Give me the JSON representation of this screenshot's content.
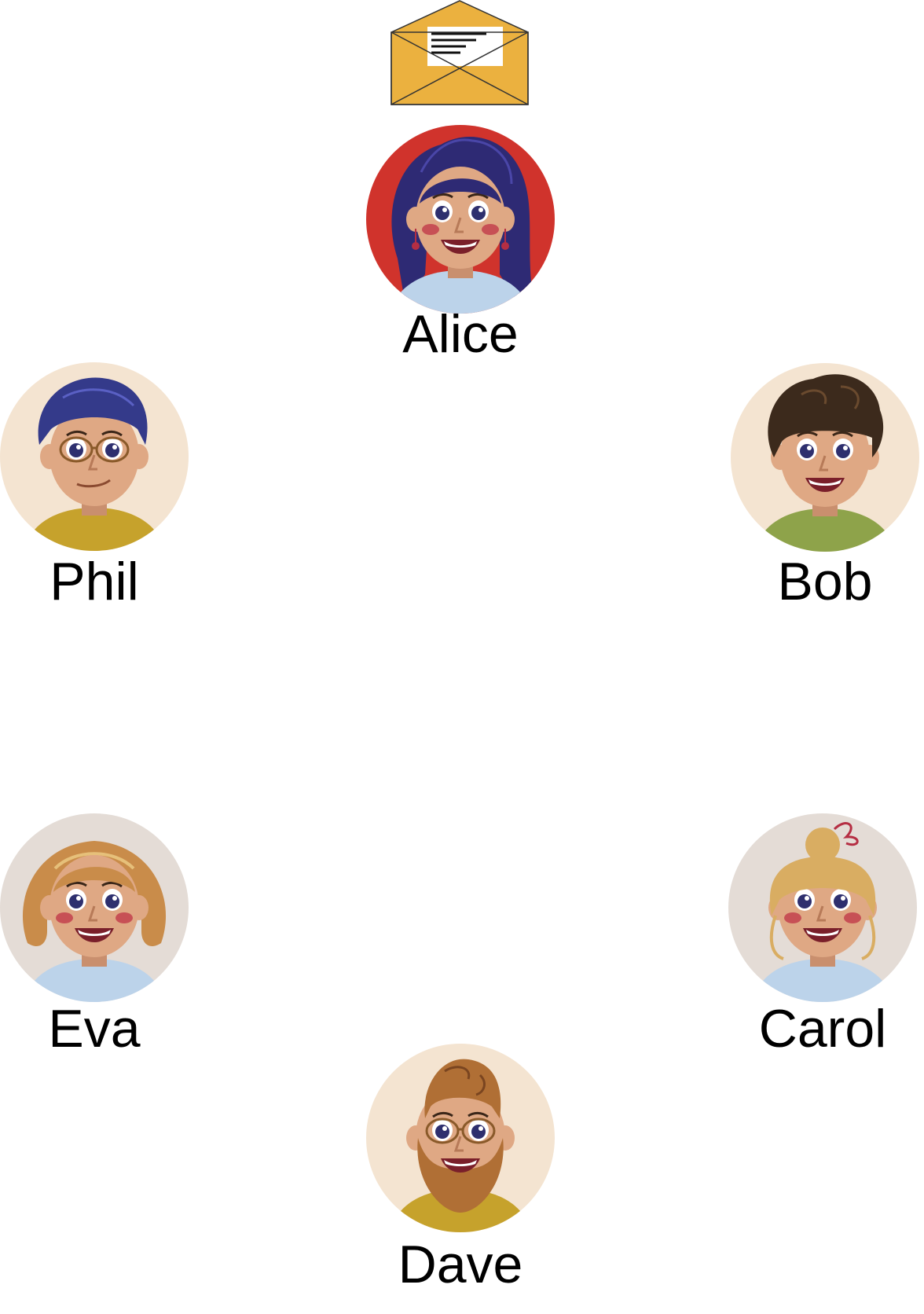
{
  "message_icon": "envelope-icon",
  "people": [
    {
      "id": "alice",
      "name": "Alice",
      "bg": "#d0332c",
      "skin": "#dfa884",
      "hair": "#2e2a74",
      "hair_style": "long-wavy",
      "shirt": "#bcd3ea",
      "glasses": false,
      "beard": false,
      "cheeks": true
    },
    {
      "id": "bob",
      "name": "Bob",
      "bg": "#f4e4d1",
      "skin": "#dfa884",
      "hair": "#3c2a1c",
      "hair_style": "curly-top",
      "shirt": "#8ea34a",
      "glasses": false,
      "beard": false,
      "cheeks": false
    },
    {
      "id": "carol",
      "name": "Carol",
      "bg": "#e4dcd6",
      "skin": "#dfa884",
      "hair": "#d9ad62",
      "hair_style": "bun",
      "shirt": "#bcd3ea",
      "glasses": false,
      "beard": false,
      "cheeks": true
    },
    {
      "id": "dave",
      "name": "Dave",
      "bg": "#f4e4d1",
      "skin": "#dfa884",
      "hair": "#b06f35",
      "hair_style": "wavy-up",
      "shirt": "#c6a22c",
      "glasses": true,
      "beard": true,
      "cheeks": false
    },
    {
      "id": "eva",
      "name": "Eva",
      "bg": "#e4dcd6",
      "skin": "#dfa884",
      "hair": "#c98c4a",
      "hair_style": "bob",
      "shirt": "#bcd3ea",
      "glasses": false,
      "beard": false,
      "cheeks": true
    },
    {
      "id": "phil",
      "name": "Phil",
      "bg": "#f4e4d1",
      "skin": "#dfa884",
      "hair": "#343a8a",
      "hair_style": "short",
      "shirt": "#c6a22c",
      "glasses": true,
      "beard": false,
      "cheeks": false
    }
  ],
  "colors": {
    "envelope": "#ebb13f",
    "label": "#000000"
  }
}
